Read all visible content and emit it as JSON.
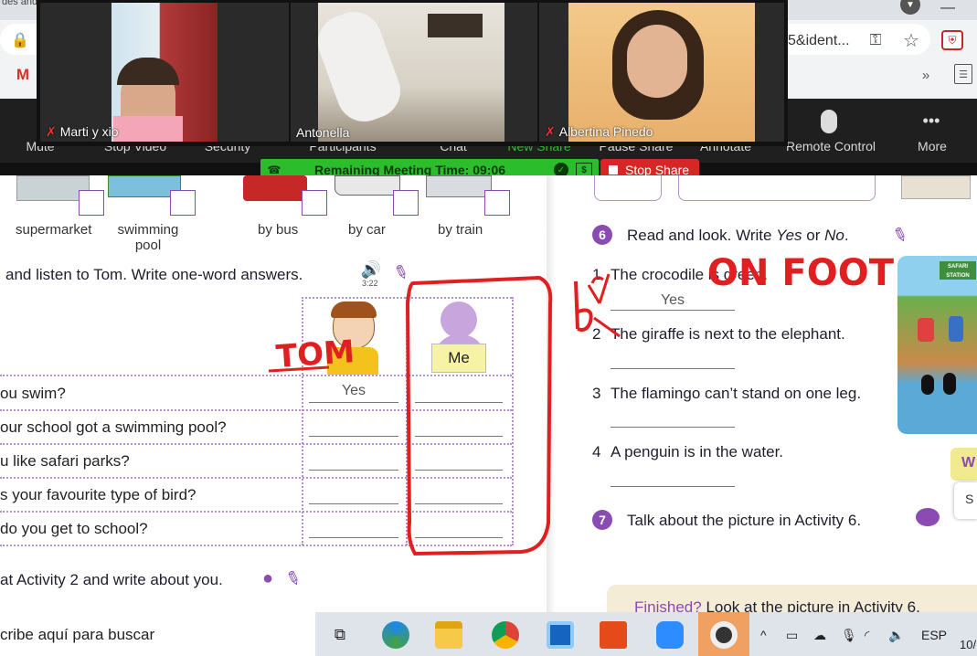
{
  "browser": {
    "tab_title_fragment": "des and",
    "address_fragment": "5&ident..."
  },
  "zoom": {
    "toolbar": [
      {
        "id": "mute",
        "label": "Mute"
      },
      {
        "id": "stop-video",
        "label": "Stop Video"
      },
      {
        "id": "security",
        "label": "Security"
      },
      {
        "id": "participants",
        "label": "Participants"
      },
      {
        "id": "chat",
        "label": "Chat"
      },
      {
        "id": "new-share",
        "label": "New Share"
      },
      {
        "id": "pause-share",
        "label": "Pause Share"
      },
      {
        "id": "annotate",
        "label": "Annotate"
      },
      {
        "id": "remote-control",
        "label": "Remote Control"
      },
      {
        "id": "more",
        "label": "More"
      }
    ],
    "participants": [
      {
        "name": "Marti y xio",
        "muted": true
      },
      {
        "name": "Antonella",
        "muted": false
      },
      {
        "name": "Albertina Pinedo",
        "muted": true
      }
    ],
    "remaining_time": "Remaining Meeting Time: 09:06",
    "stop_share": "Stop Share",
    "colors": {
      "green": "#2bbd2b",
      "red": "#d62626",
      "bar": "#1f1f1f"
    }
  },
  "worksheet": {
    "transport_labels": [
      "supermarket",
      "swimming pool",
      "by bus",
      "by car",
      "by train"
    ],
    "listen_instruction": "and listen to Tom. Write one-word answers.",
    "audio_time": "3:22",
    "columns": {
      "tom": "Tom",
      "me": "Me"
    },
    "questions": [
      {
        "text": "ou swim?",
        "tom": "Yes"
      },
      {
        "text": "our school got a swimming pool?",
        "tom": ""
      },
      {
        "text": "u like safari parks?",
        "tom": ""
      },
      {
        "text": "s your favourite type of bird?",
        "tom": ""
      },
      {
        "text": "do you get to school?",
        "tom": ""
      }
    ],
    "activity3": "at Activity 2 and write about you.",
    "activity6_num": "6",
    "activity6_title_pre": "Read and look. Write ",
    "activity6_yes": "Yes",
    "activity6_or": " or ",
    "activity6_no": "No",
    "activity6_end": ".",
    "statements": [
      {
        "n": "1",
        "text": "The crocodile is green.",
        "answer": "Yes"
      },
      {
        "n": "2",
        "text": "The giraffe is next to the elephant.",
        "answer": ""
      },
      {
        "n": "3",
        "text": "The flamingo can’t stand on one leg.",
        "answer": ""
      },
      {
        "n": "4",
        "text": "A penguin is in the water.",
        "answer": ""
      }
    ],
    "activity7_num": "7",
    "activity7": "Talk about the picture in Activity 6.",
    "finished": "Finished?",
    "finished_rest": " Look at the picture in Activity 6.",
    "annotations": {
      "tom": "TOM",
      "on_foot": "ON FOOT",
      "by": "by"
    },
    "side_badge": "W",
    "side_badge2": "S",
    "poster_text": "SAFARI STATION"
  },
  "taskbar": {
    "search_placeholder": "cribe aquí para buscar",
    "lang": "ESP",
    "date_fragment": "10/"
  }
}
